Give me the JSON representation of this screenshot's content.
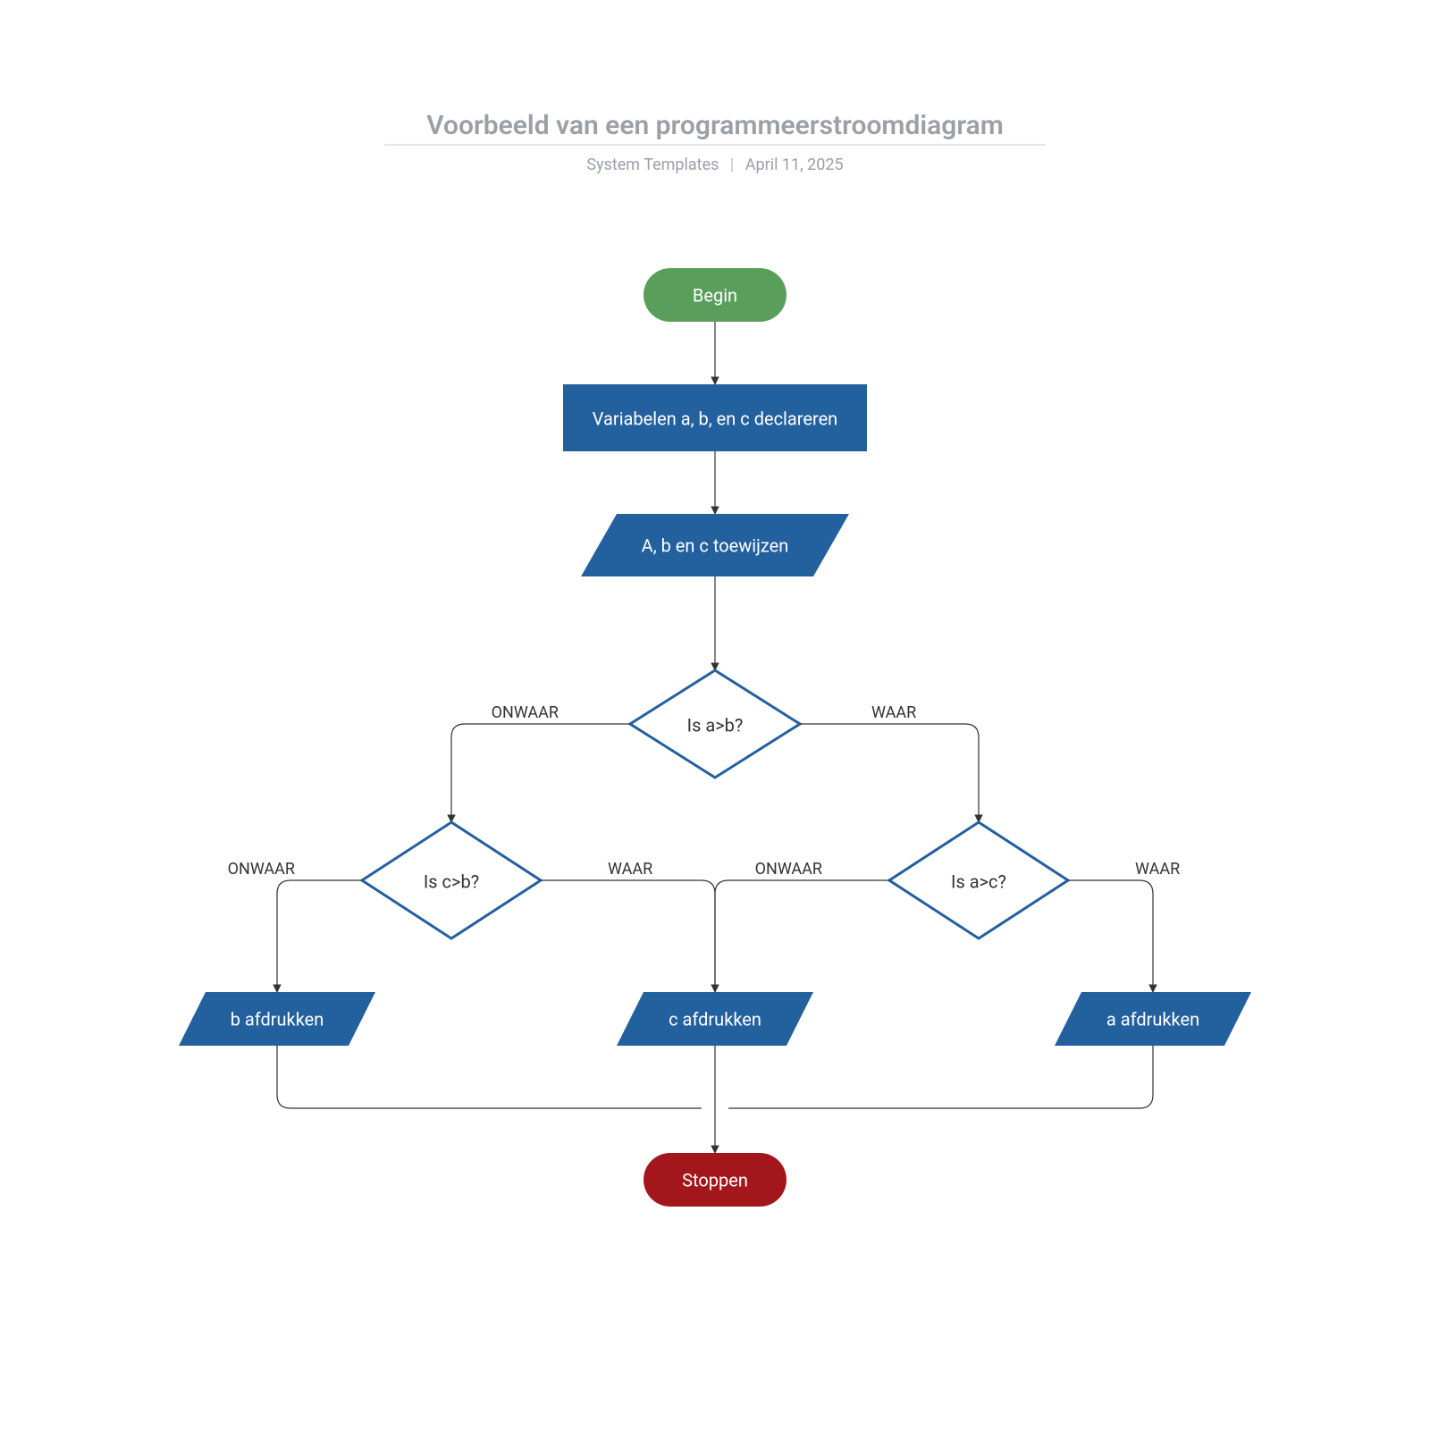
{
  "header": {
    "title": "Voorbeeld van een programmeerstroomdiagram",
    "author": "System Templates",
    "date": "April 11, 2025"
  },
  "nodes": {
    "begin": "Begin",
    "declare": "Variabelen a, b, en c declareren",
    "assign": "A, b en c toewijzen",
    "dec1": "Is a>b?",
    "dec2": "Is c>b?",
    "dec3": "Is a>c?",
    "print_b": "b afdrukken",
    "print_c": "c afdrukken",
    "print_a": "a afdrukken",
    "stop": "Stoppen"
  },
  "labels": {
    "true": "WAAR",
    "false": "ONWAAR"
  }
}
